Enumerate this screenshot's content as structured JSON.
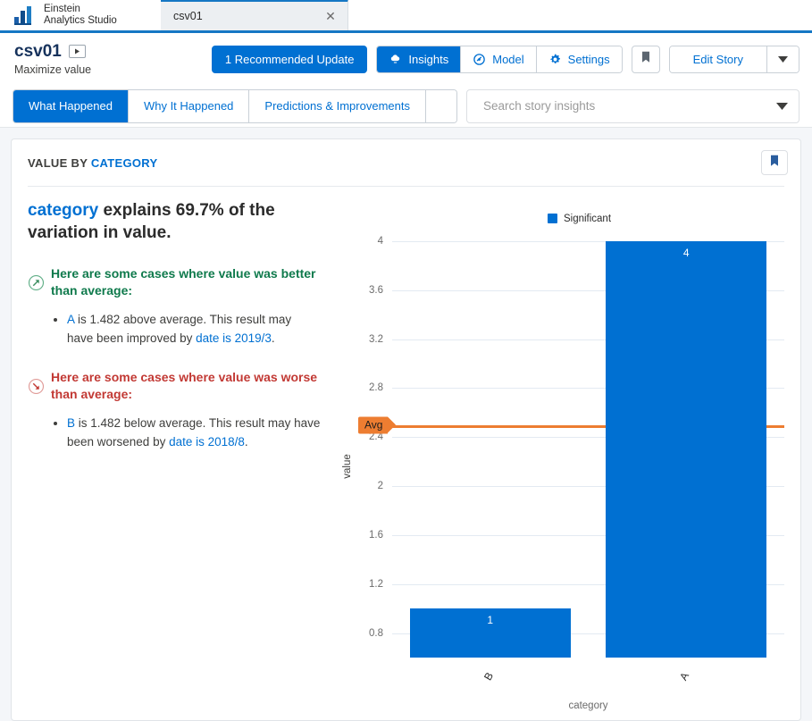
{
  "browser": {
    "brand_line1": "Einstein",
    "brand_line2": "Analytics Studio",
    "logo_icon": "bar-chart-logo",
    "tabs": [
      {
        "title": "csv01",
        "close_icon": "close-icon"
      }
    ]
  },
  "header": {
    "story_title": "csv01",
    "story_subtitle": "Maximize value",
    "play_icon": "play-icon",
    "recommended_update_label": "1 Recommended Update",
    "view_switch": [
      {
        "label": "Insights",
        "icon": "insights-icon",
        "active": true
      },
      {
        "label": "Model",
        "icon": "model-icon",
        "active": false
      },
      {
        "label": "Settings",
        "icon": "gear-icon",
        "active": false
      }
    ],
    "bookmark_icon": "bookmark-icon",
    "edit_story_label": "Edit Story",
    "edit_story_caret_icon": "chevron-down-icon"
  },
  "tabs_row": {
    "tabs": [
      {
        "label": "What Happened",
        "active": true
      },
      {
        "label": "Why It Happened",
        "active": false
      },
      {
        "label": "Predictions & Improvements",
        "active": false
      }
    ],
    "overflow_caret_icon": "chevron-down-icon",
    "search": {
      "placeholder": "Search story insights",
      "value": "",
      "caret_icon": "chevron-down-icon"
    }
  },
  "card": {
    "eyebrow_prefix": "VALUE BY ",
    "eyebrow_highlight": "CATEGORY",
    "bookmark_icon": "bookmark-icon",
    "headline_highlight": "category",
    "headline_rest": " explains 69.7% of the variation in value.",
    "insights": [
      {
        "icon": "arrow-up-right-circle-icon",
        "tone": "good",
        "title": "Here are some cases where value was better than average:",
        "bullets": [
          {
            "lead": "A",
            "mid": " is 1.482 above average. This result may have been improved by ",
            "link": "date is 2019/3",
            "tail": "."
          }
        ]
      },
      {
        "icon": "arrow-down-right-circle-icon",
        "tone": "bad",
        "title": "Here are some cases where value was worse than average:",
        "bullets": [
          {
            "lead": "B",
            "mid": " is 1.482 below average. This result may have been worsened by ",
            "link": "date is 2018/8",
            "tail": "."
          }
        ]
      }
    ]
  },
  "chart_data": {
    "type": "bar",
    "title": "",
    "categories": [
      "B",
      "A"
    ],
    "values": [
      1,
      4
    ],
    "bar_labels": [
      "1",
      "4"
    ],
    "xlabel": "category",
    "ylabel": "value",
    "ylim": [
      0.6,
      4.08
    ],
    "yticks": [
      0.8,
      1.2,
      1.6,
      2,
      2.4,
      2.8,
      3.2,
      3.6,
      4
    ],
    "ytick_labels": [
      "0.8",
      "1.2",
      "1.6",
      "2",
      "2.4",
      "2.8",
      "3.2",
      "3.6",
      "4"
    ],
    "grid": true,
    "legend": {
      "position": "top",
      "entries": [
        {
          "label": "Significant",
          "color": "#0070d2"
        }
      ]
    },
    "reference_line": {
      "label": "Avg",
      "value": 2.5,
      "color": "#ed7d31"
    },
    "series_color": "#0070d2"
  },
  "colors": {
    "brand_blue": "#0070d2",
    "tab_border_blue": "#1577c4",
    "orange": "#ed7d31",
    "good_green": "#0f7a4c",
    "bad_red": "#c23934",
    "page_bg": "#f4f6f9"
  }
}
